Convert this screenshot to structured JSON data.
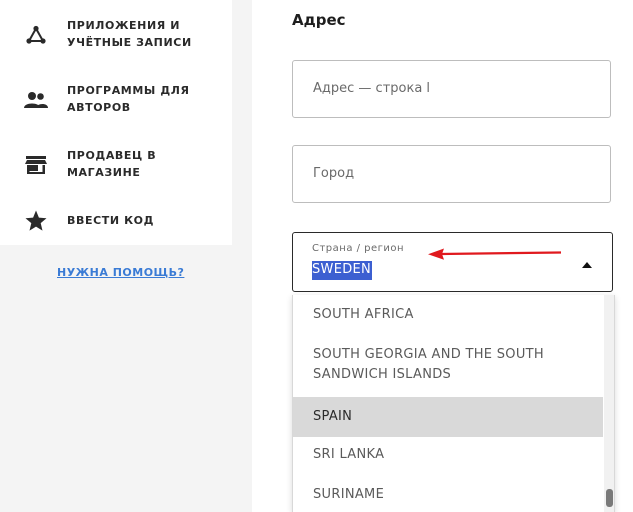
{
  "sidebar": {
    "items": [
      {
        "label": "ПРИЛОЖЕНИЯ И УЧЁТНЫЕ ЗАПИСИ",
        "icon": "connected-apps-icon"
      },
      {
        "label": "ПРОГРАММЫ ДЛЯ АВТОРОВ",
        "icon": "people-icon"
      },
      {
        "label": "ПРОДАВЕЦ В МАГАЗИНЕ",
        "icon": "store-icon"
      },
      {
        "label": "ВВЕСТИ КОД",
        "icon": "star-icon"
      }
    ],
    "help_link": "НУЖНА ПОМОЩЬ?"
  },
  "address": {
    "title": "Адрес",
    "line1_placeholder": "Адрес — строка l",
    "city_placeholder": "Город",
    "country_label": "Страна / регион",
    "country_value": "SWEDEN"
  },
  "dropdown": {
    "options": [
      "SOUTH AFRICA",
      "SOUTH GEORGIA AND THE SOUTH SANDWICH ISLANDS",
      "SPAIN",
      "SRI LANKA",
      "SURINAME"
    ],
    "highlighted": "SPAIN"
  },
  "colors": {
    "accent": "#3c5fd1",
    "link": "#3a7bd5",
    "annotation_arrow": "#e0191e",
    "highlight_row": "#d9d9d9"
  }
}
